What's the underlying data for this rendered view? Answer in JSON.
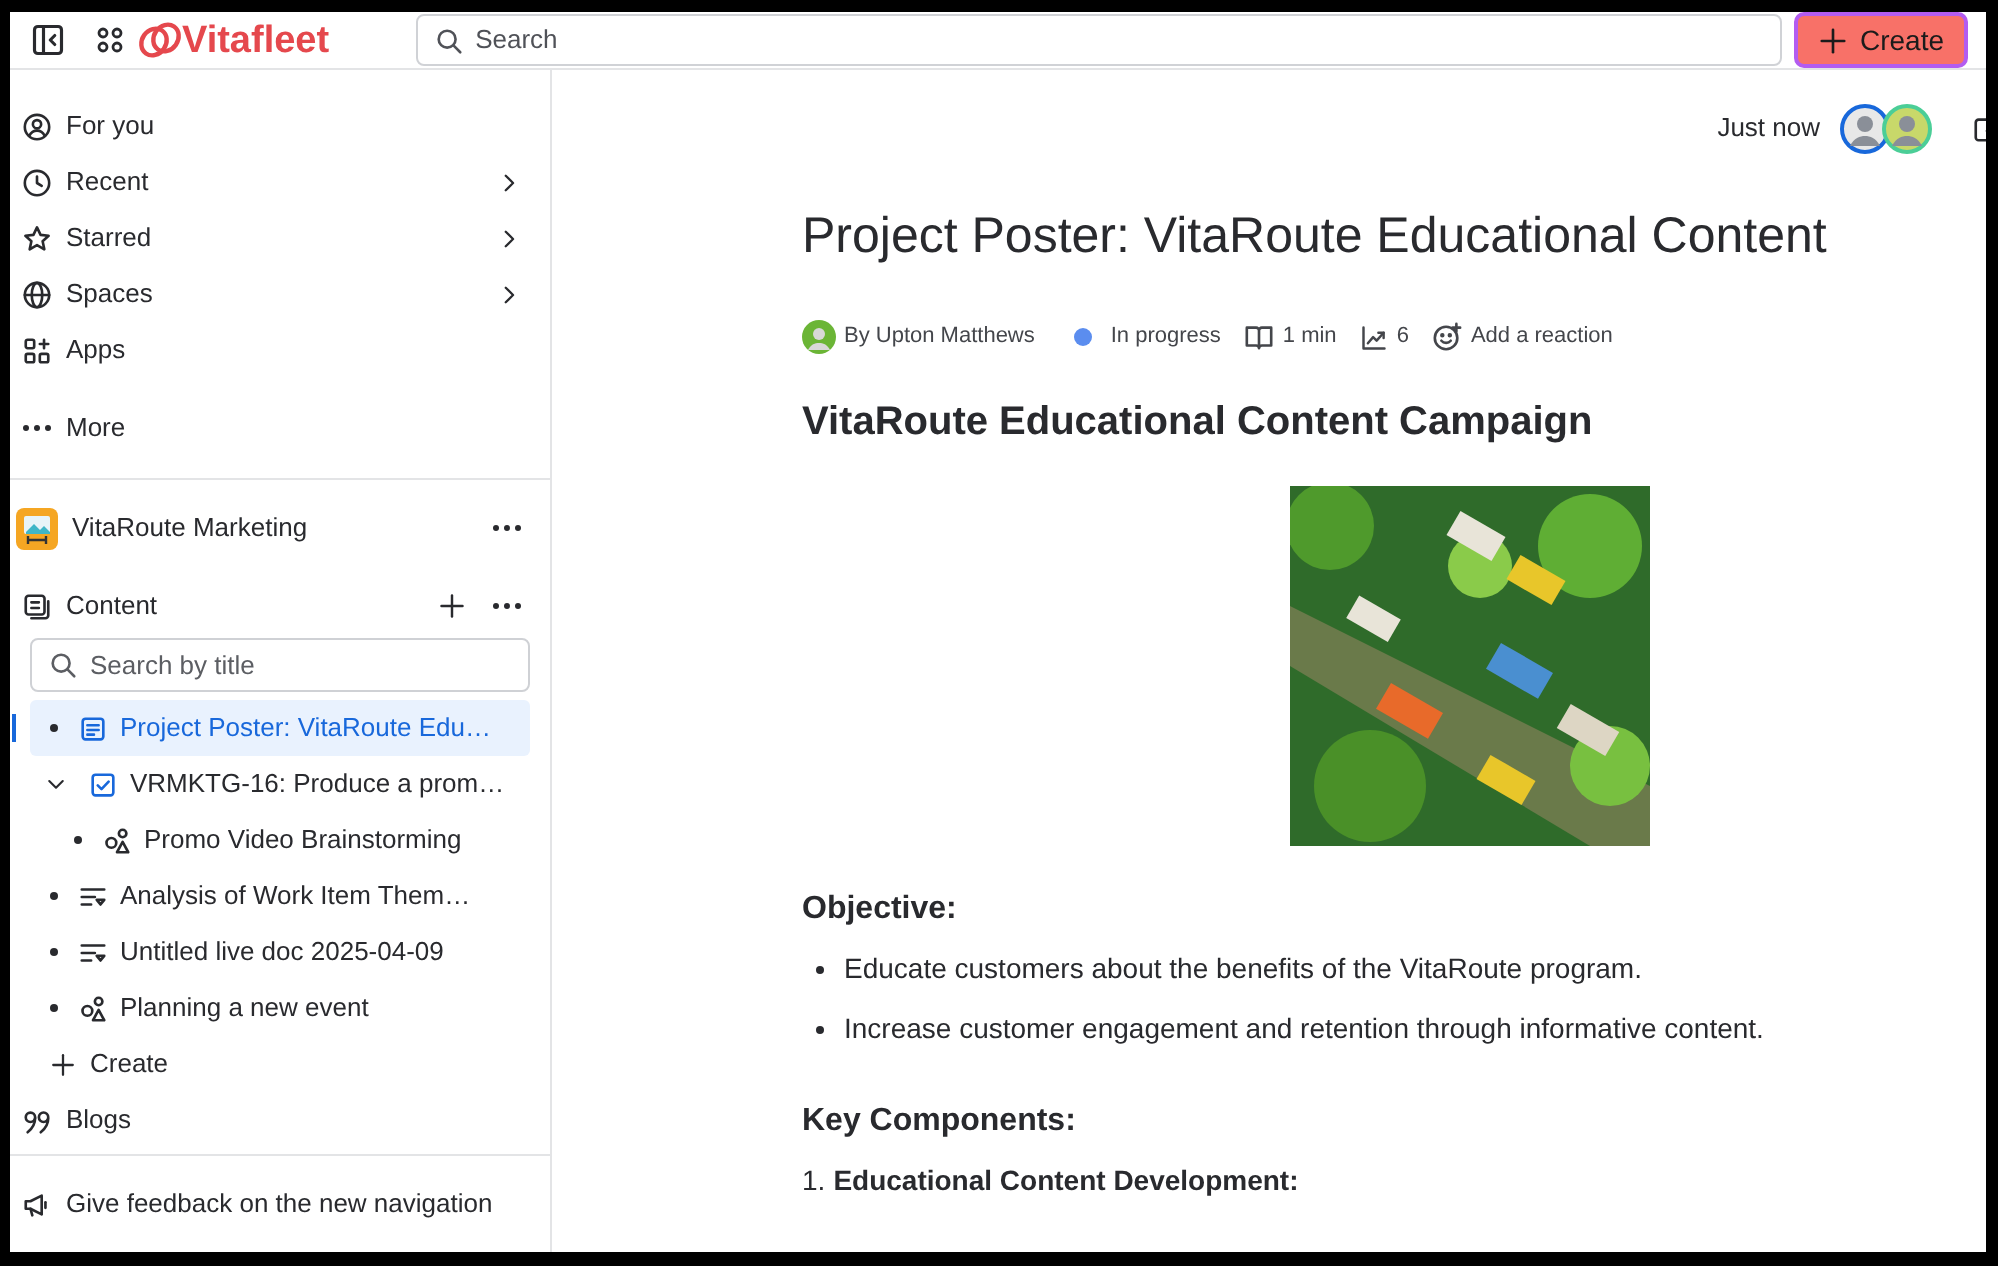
{
  "header": {
    "logo_text": "Vitafleet",
    "search_placeholder": "Search",
    "create_button": "Create"
  },
  "sidebar": {
    "nav": [
      {
        "label": "For you",
        "has_submenu": false
      },
      {
        "label": "Recent",
        "has_submenu": true
      },
      {
        "label": "Starred",
        "has_submenu": true
      },
      {
        "label": "Spaces",
        "has_submenu": true
      },
      {
        "label": "Apps",
        "has_submenu": false
      },
      {
        "label": "More",
        "has_submenu": false
      }
    ],
    "space_name": "VitaRoute Marketing",
    "content_label": "Content",
    "tree_search_placeholder": "Search by title",
    "tree": [
      {
        "label": "Project Poster: VitaRoute Edu…",
        "kind": "page",
        "selected": true
      },
      {
        "label": "VRMKTG-16: Produce a prom…",
        "kind": "task",
        "selected": false,
        "expanded": true,
        "children": [
          {
            "label": "Promo Video Brainstorming",
            "kind": "whiteboard",
            "selected": false
          }
        ]
      },
      {
        "label": "Analysis of Work Item Them…",
        "kind": "livedoc",
        "selected": false
      },
      {
        "label": "Untitled live doc 2025-04-09",
        "kind": "livedoc",
        "selected": false
      },
      {
        "label": "Planning a new event",
        "kind": "whiteboard",
        "selected": false
      }
    ],
    "create_label": "Create",
    "blogs_label": "Blogs",
    "feedback_label": "Give feedback on the new navigation"
  },
  "page": {
    "timestamp": "Just now",
    "title": "Project Poster: VitaRoute Educational Content",
    "meta": {
      "author": "By Upton Matthews",
      "status": {
        "label": "In progress",
        "color": "#5b8def"
      },
      "read_time": "1 min",
      "views": "6",
      "reaction": "Add a reaction"
    },
    "heading": "VitaRoute Educational Content Campaign",
    "objective_heading": "Objective:",
    "objectives": [
      "Educate customers about the benefits of the VitaRoute program.",
      "Increase customer engagement and retention through informative content."
    ],
    "components_heading": "Key Components:",
    "components": [
      {
        "number": "1.",
        "label": "Educational Content Development:"
      }
    ]
  }
}
